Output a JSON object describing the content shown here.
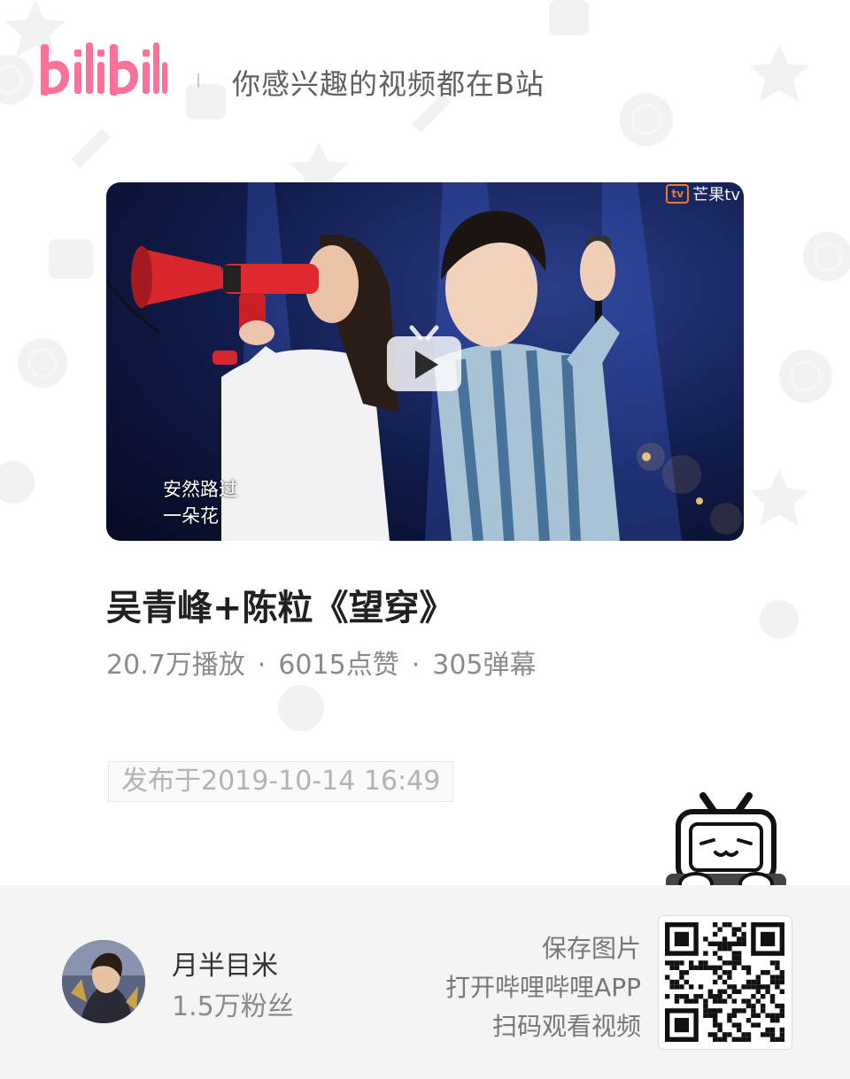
{
  "header": {
    "logo_text": "bilibili",
    "tagline": "你感兴趣的视频都在B站"
  },
  "video": {
    "cover": {
      "subtitle_line1": "安然路过",
      "subtitle_line2": "一朵花",
      "watermark": "芒果tv"
    },
    "title": "吴青峰+陈粒《望穿》",
    "stats": {
      "plays": "20.7万播放",
      "likes": "6015点赞",
      "danmaku": "305弹幕",
      "separator": "·"
    },
    "published": "发布于2019-10-14 16:49"
  },
  "uploader": {
    "name": "月半目米",
    "fans": "1.5万粉丝"
  },
  "footer": {
    "hint_line1": "保存图片",
    "hint_line2": "打开哔哩哔哩APP",
    "hint_line3": "扫码观看视频"
  },
  "colors": {
    "brand_pink": "#fb7299",
    "title_text": "#212121",
    "muted_text": "#8a8a8a",
    "footer_bg": "#f4f4f4"
  },
  "icons": [
    "bilibili-logo",
    "play-icon",
    "tv-mascot-icon",
    "qr-code"
  ]
}
